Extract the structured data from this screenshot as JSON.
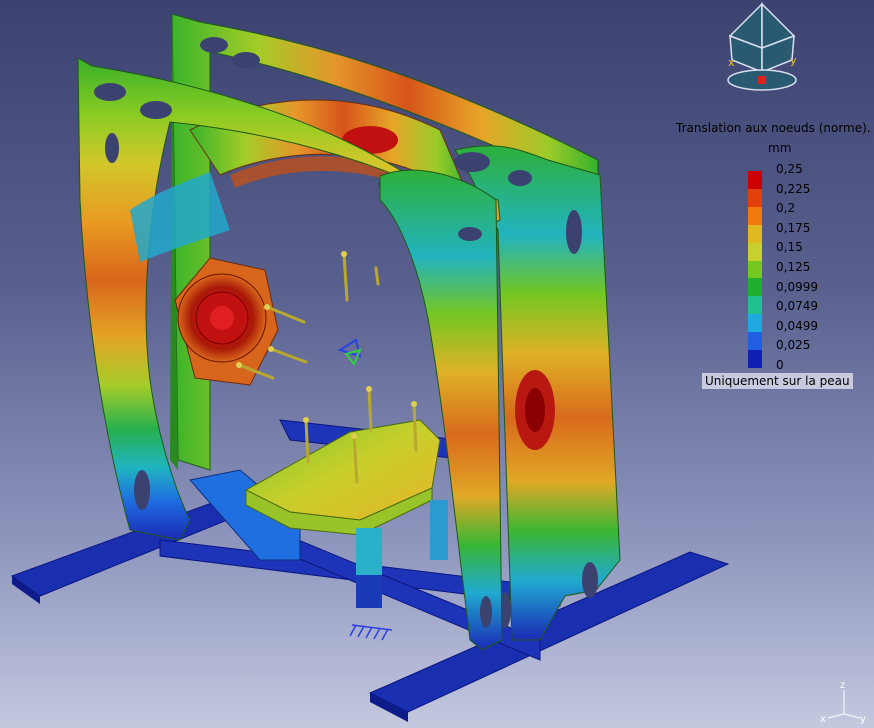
{
  "legend": {
    "title": "Translation aux noeuds (norme).",
    "unit": "mm",
    "ticks": [
      "0,25",
      "0,225",
      "0,2",
      "0,175",
      "0,15",
      "0,125",
      "0,0999",
      "0,0749",
      "0,0499",
      "0,025",
      "0"
    ],
    "colors": [
      "#cc0000",
      "#e0400a",
      "#f07a10",
      "#e0b820",
      "#c8d030",
      "#74c820",
      "#20b030",
      "#20c090",
      "#20a8e0",
      "#2060e0",
      "#1020b0"
    ],
    "note": "Uniquement sur la peau"
  },
  "compass": {
    "x_label": "x",
    "y_label": "y"
  },
  "axis_triad": {
    "z_label": "z",
    "x_label": "x",
    "y_label": "y"
  },
  "colors": {
    "background_top": "#3c4270",
    "background_bottom": "#c4c9df",
    "base_blue": "#1a2fb0"
  }
}
